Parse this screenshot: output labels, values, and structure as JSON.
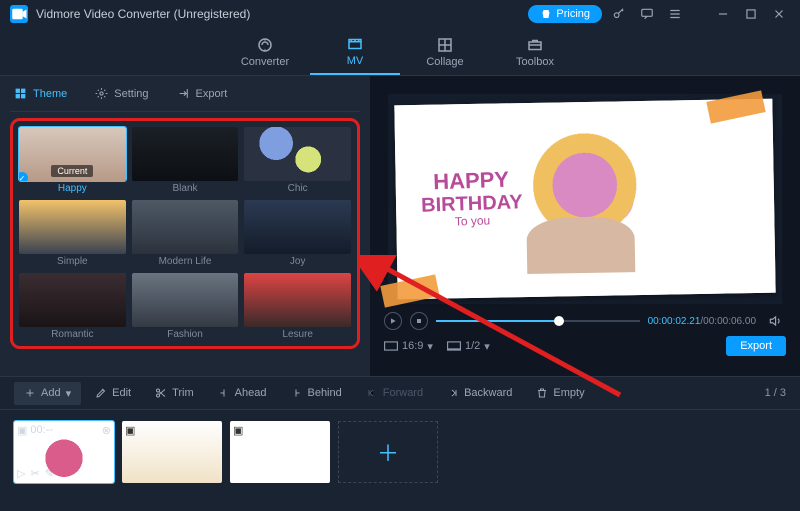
{
  "window": {
    "title": "Vidmore Video Converter (Unregistered)",
    "pricing": "Pricing"
  },
  "nav": {
    "converter": "Converter",
    "mv": "MV",
    "collage": "Collage",
    "toolbox": "Toolbox"
  },
  "subtabs": {
    "theme": "Theme",
    "setting": "Setting",
    "export": "Export"
  },
  "themes": {
    "current_badge": "Current",
    "row1": [
      {
        "label": "Happy",
        "selected": true
      },
      {
        "label": "Blank"
      },
      {
        "label": "Chic"
      }
    ],
    "row2": [
      {
        "label": "Simple"
      },
      {
        "label": "Modern Life"
      },
      {
        "label": "Joy"
      }
    ],
    "row3": [
      {
        "label": "Romantic"
      },
      {
        "label": "Fashion"
      },
      {
        "label": "Lesure"
      }
    ]
  },
  "preview": {
    "hb1": "HAPPY",
    "hb2": "BIRTHDAY",
    "hb3": "To you",
    "time_current": "00:00:02.21",
    "time_sep": "/",
    "time_total": "00:00:06.00",
    "aspect": "16:9",
    "page": "1/2",
    "export": "Export"
  },
  "toolbar": {
    "add": "Add",
    "edit": "Edit",
    "trim": "Trim",
    "ahead": "Ahead",
    "behind": "Behind",
    "forward": "Forward",
    "backward": "Backward",
    "empty": "Empty",
    "page": "1 / 3"
  },
  "timeline": {
    "time_badge": "00:--"
  }
}
